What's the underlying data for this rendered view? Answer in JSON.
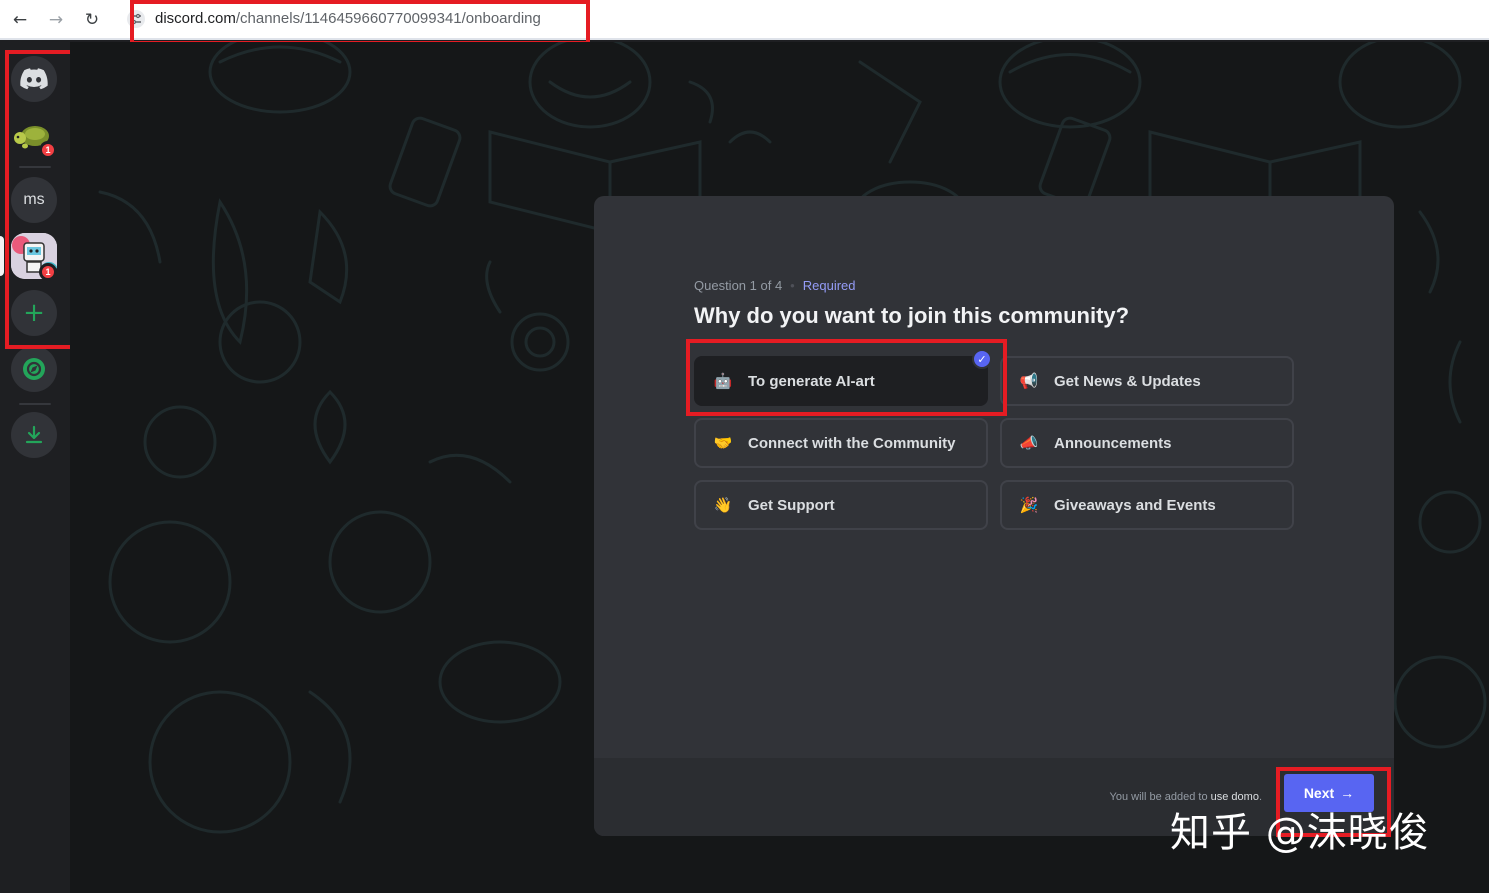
{
  "browser": {
    "url_host": "discord.com",
    "url_path": "/channels/1146459660770099341/onboarding",
    "back_icon": "←",
    "forward_icon": "→",
    "reload_icon": "↻"
  },
  "rail": {
    "home_icon": "discord-logo-icon",
    "ms_label": "ms",
    "turtle_badge": "1",
    "robot_badge": "1",
    "add_icon": "+",
    "download_icon": "download-icon"
  },
  "onboarding": {
    "question_counter": "Question 1 of 4",
    "required_label": "Required",
    "title": "Why do you want to join this community?",
    "options": [
      {
        "label": "To generate AI-art",
        "emoji": "🤖",
        "selected": true
      },
      {
        "label": "Get News & Updates",
        "emoji": "📢",
        "selected": false
      },
      {
        "label": "Connect with the Community",
        "emoji": "🤝",
        "selected": false
      },
      {
        "label": "Announcements",
        "emoji": "📣",
        "selected": false
      },
      {
        "label": "Get Support",
        "emoji": "👋",
        "selected": false
      },
      {
        "label": "Giveaways and Events",
        "emoji": "🎉",
        "selected": false
      }
    ],
    "footer_prefix": "You will be added to ",
    "footer_server": "use domo",
    "footer_suffix": ".",
    "next_label": "Next",
    "next_arrow": "→"
  },
  "watermark": "知乎 @沫晓俊",
  "colors": {
    "accent": "#5865f2",
    "required": "#949cf7",
    "annotation": "#e51c23",
    "rail_green": "#23a55a"
  }
}
